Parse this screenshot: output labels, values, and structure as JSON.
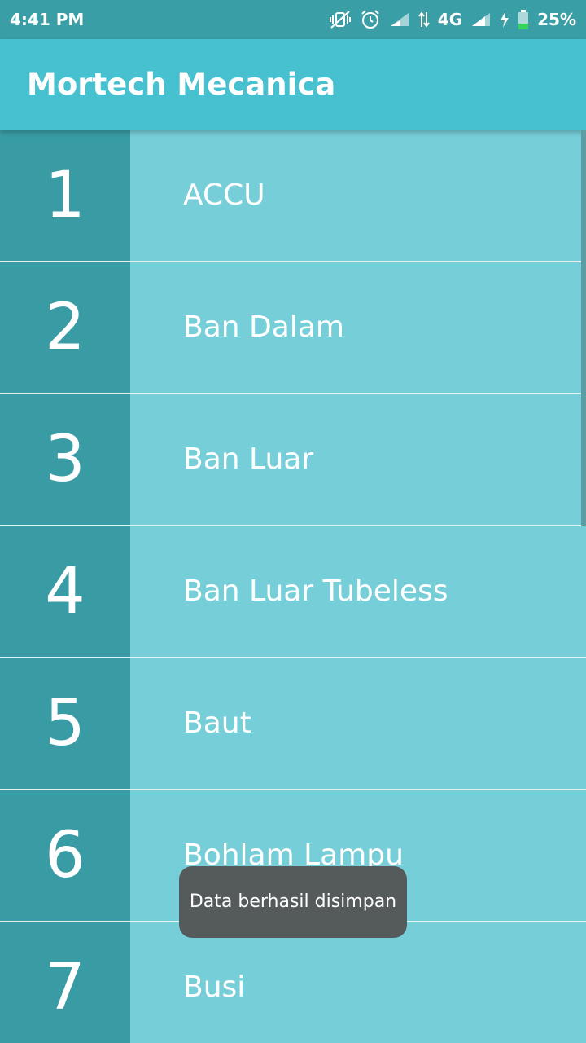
{
  "status_bar": {
    "time": "4:41 PM",
    "network": "4G",
    "battery": "25%",
    "icons": [
      "vibrate-off-icon",
      "alarm-icon",
      "signal-icon",
      "data-arrows-icon",
      "charging-icon",
      "battery-icon"
    ]
  },
  "app_bar": {
    "title": "Mortech Mecanica",
    "color": "#47c1cf"
  },
  "list": {
    "items": [
      {
        "number": "1",
        "label": "ACCU"
      },
      {
        "number": "2",
        "label": "Ban Dalam"
      },
      {
        "number": "3",
        "label": "Ban Luar"
      },
      {
        "number": "4",
        "label": "Ban Luar Tubeless"
      },
      {
        "number": "5",
        "label": "Baut"
      },
      {
        "number": "6",
        "label": "Bohlam Lampu"
      },
      {
        "number": "7",
        "label": "Busi"
      }
    ],
    "number_cell_color": "#399ca4",
    "label_cell_color": "#76ced8"
  },
  "toast": {
    "message": "Data berhasil disimpan"
  }
}
